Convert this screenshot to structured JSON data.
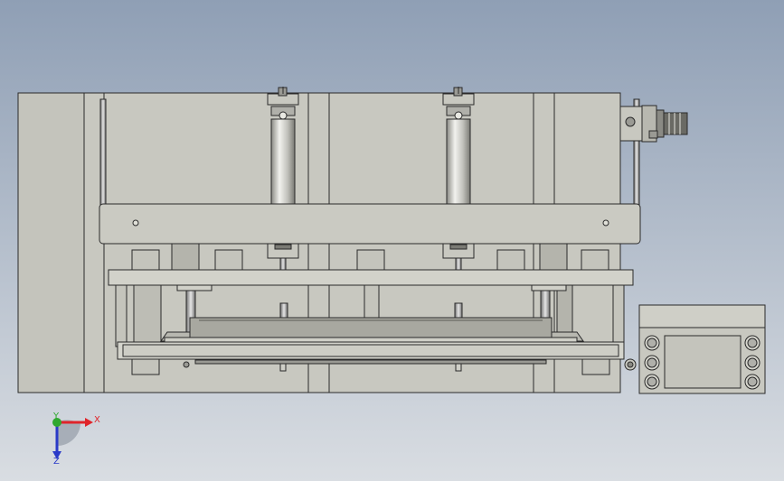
{
  "viewport": {
    "background_top": "#8f9fb5",
    "background_bottom": "#d9dde2"
  },
  "machine": {
    "frame_fill": "#c8c8c0",
    "frame_stroke": "#2a2a2a",
    "shade_fill": "#b9b9b0",
    "highlight_fill": "#dcdcd4",
    "cylinder_fill": "#d8d8d2",
    "screen_fill": "#c4c4bc"
  },
  "triad": {
    "x_label": "X",
    "y_label": "Y",
    "z_label": "Z",
    "x_color": "#e0242a",
    "y_color": "#2fa82f",
    "z_color": "#2a3ac8"
  }
}
